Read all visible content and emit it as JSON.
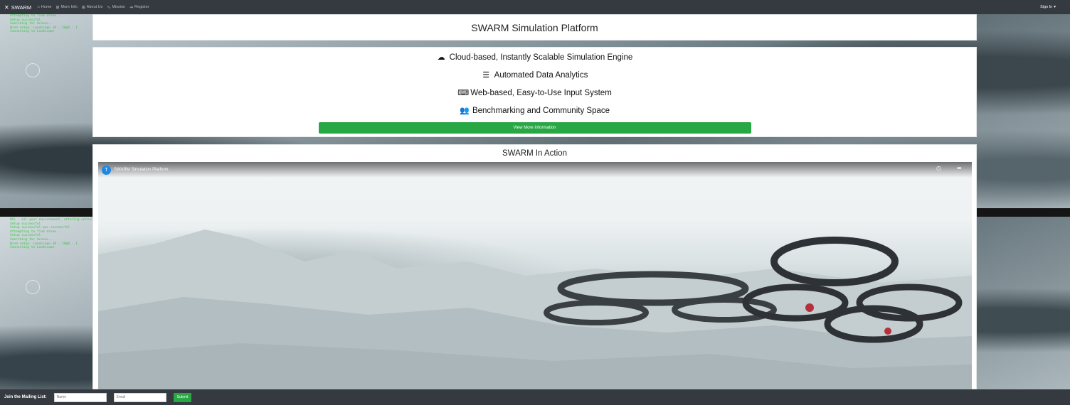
{
  "nav": {
    "brand": "SWARM",
    "items": [
      {
        "icon": "home-icon",
        "glyph": "⌂",
        "label": "Home"
      },
      {
        "icon": "info-icon",
        "glyph": "⊞",
        "label": "More Info"
      },
      {
        "icon": "about-icon",
        "glyph": "⊞",
        "label": "About Us"
      },
      {
        "icon": "mission-icon",
        "glyph": "∿",
        "label": "Mission"
      },
      {
        "icon": "register-icon",
        "glyph": "➜",
        "label": "Register"
      }
    ],
    "signin_label": "Sign In"
  },
  "background_log": {
    "top_lines": [
      "Attempting to find drone...",
      "Setup successful",
      "Searching for drones...",
      "Wind setup: Landscape 10 - 50@0 - 1",
      "Connecting to Landscape"
    ],
    "bottom_lines": [
      "UFL - all your environment, entering unreal mode for safety",
      "Setup successful",
      "Setup successful was successful",
      "Attempting to find drone...",
      "Setup successful",
      "Searching for drones...",
      "Wind setup: Landscape 10 - 50@0 - 1",
      "Connecting to Landscape"
    ]
  },
  "title_card": {
    "title": "SWARM Simulation Platform"
  },
  "features": [
    {
      "icon": "cloud-upload-icon",
      "glyph": "☁",
      "label": "Cloud-based, Instantly Scalable Simulation Engine"
    },
    {
      "icon": "database-icon",
      "glyph": "☰",
      "label": "Automated Data Analytics"
    },
    {
      "icon": "keyboard-icon",
      "glyph": "⌨",
      "label": "Web-based, Easy-to-Use Input System"
    },
    {
      "icon": "users-icon",
      "glyph": "👥",
      "label": "Benchmarking and Community Space"
    }
  ],
  "more_button_label": "View More Information",
  "video_section": {
    "heading": "SWARM In Action",
    "channel_initial": "T",
    "video_title": "SWARM Simulation Platform"
  },
  "footer": {
    "label": "Join the Mailing List:",
    "name_placeholder": "Name",
    "email_placeholder": "Email",
    "submit_label": "Submit"
  },
  "colors": {
    "navbar": "#343a40",
    "accent_green": "#28a745",
    "log_green": "#3ec24a"
  }
}
